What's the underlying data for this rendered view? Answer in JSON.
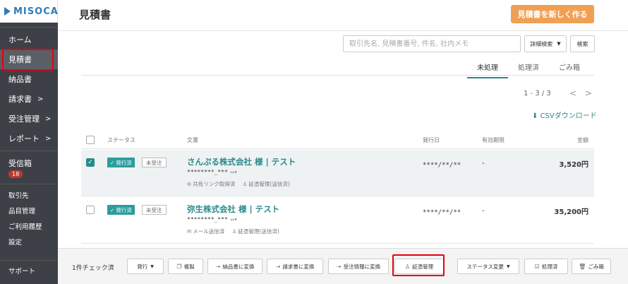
{
  "app": {
    "logo": "MISOCA"
  },
  "sidebar": {
    "items": [
      {
        "label": "ホーム"
      },
      {
        "label": "見積書"
      },
      {
        "label": "納品書"
      },
      {
        "label": "請求書"
      },
      {
        "label": "受注管理"
      },
      {
        "label": "レポート"
      }
    ],
    "inbox": {
      "label": "受信箱",
      "count": "18"
    },
    "secondary": [
      {
        "label": "取引先"
      },
      {
        "label": "品目管理"
      },
      {
        "label": "ご利用履歴"
      },
      {
        "label": "設定"
      }
    ],
    "support": "サポート"
  },
  "header": {
    "title": "見積書",
    "new_button": "見積書を新しく作る"
  },
  "search": {
    "placeholder": "取引先名, 見積書番号, 件名, 社内メモ",
    "detail_button": "詳細検索",
    "search_button": "検索"
  },
  "tabs": [
    {
      "label": "未処理"
    },
    {
      "label": "処理済"
    },
    {
      "label": "ごみ箱"
    }
  ],
  "pager": {
    "range": "1 - 3 / 3"
  },
  "csv": "CSVダウンロード",
  "table": {
    "headers": {
      "status": "ステータス",
      "document": "文書",
      "issue_date": "発行日",
      "expiry": "有効期限",
      "amount": "金額"
    },
    "rows": [
      {
        "status": "発行済",
        "order_status": "未受注",
        "title": "さんぷる株式会社 様 | テスト",
        "number": "********_***",
        "meta1": "共有リンク取得済",
        "meta2": "証憑管理(送信済)",
        "issue_date": "****/**/**",
        "expiry": "-",
        "amount": "3,520円"
      },
      {
        "status": "発行済",
        "order_status": "未受注",
        "title": "弥生株式会社 様 | テスト",
        "number": "********_***",
        "meta1": "メール送信済",
        "meta2": "証憑管理(送信済)",
        "issue_date": "****/**/**",
        "expiry": "-",
        "amount": "35,200円"
      }
    ]
  },
  "bottom_bar": {
    "checked_count": "1件チェック済",
    "buttons": {
      "issue": "発行",
      "copy": "複製",
      "to_delivery": "納品書に変換",
      "to_invoice": "請求書に変換",
      "to_order": "受注情報に変換",
      "evidence": "証憑管理",
      "status_change": "ステータス変更",
      "processed": "処理済",
      "trash": "ごみ箱"
    }
  },
  "colors": {
    "accent": "#2a8a8a",
    "primary_button": "#f0a055",
    "sidebar_bg": "#3d4147",
    "highlight": "#e60012"
  }
}
